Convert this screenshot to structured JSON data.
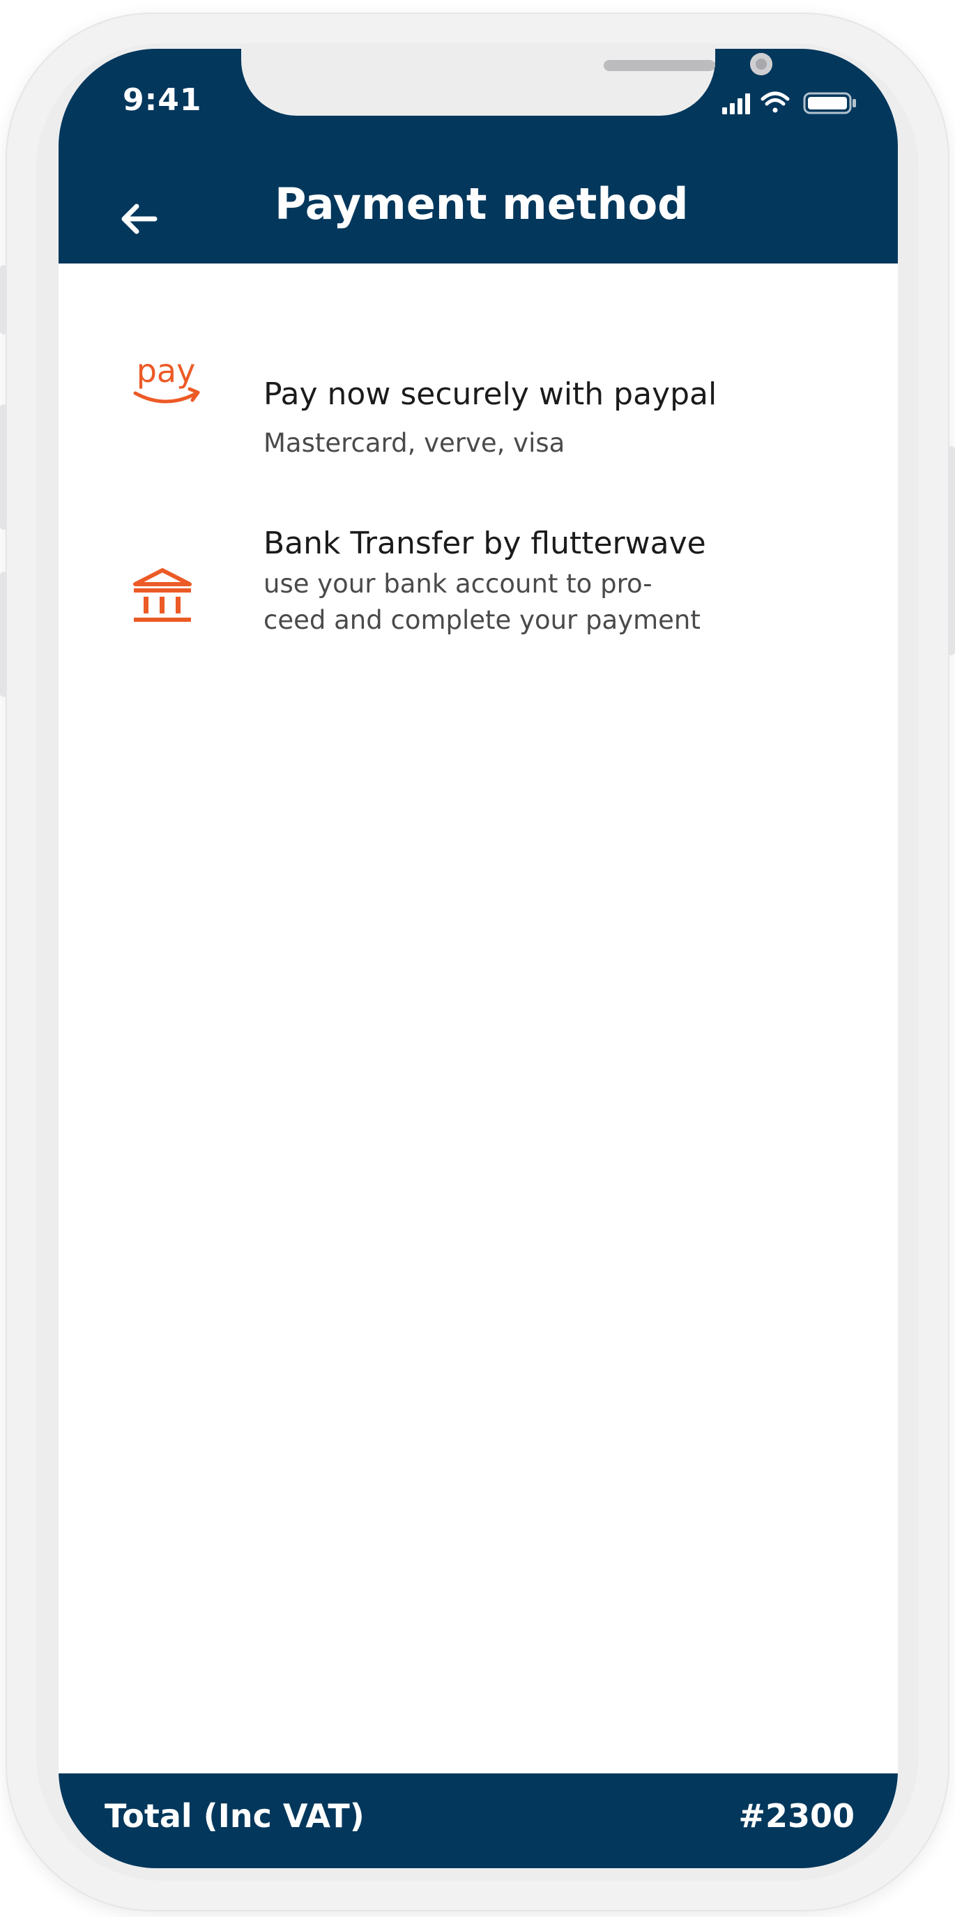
{
  "status_bar": {
    "time": "9:41"
  },
  "header": {
    "title": "Payment method",
    "background_color": "#03375c"
  },
  "payment_options": [
    {
      "icon": "pay-logo-icon",
      "logo_text": "pay",
      "title": "Pay now securely with paypal",
      "description": "Mastercard, verve, visa"
    },
    {
      "icon": "bank-icon",
      "title": "Bank Transfer by flutterwave",
      "description": "use your bank account to pro-ceed and complete your payment"
    }
  ],
  "footer": {
    "label": "Total (Inc VAT)",
    "amount": "#2300"
  },
  "accent_color": "#ec5a26"
}
